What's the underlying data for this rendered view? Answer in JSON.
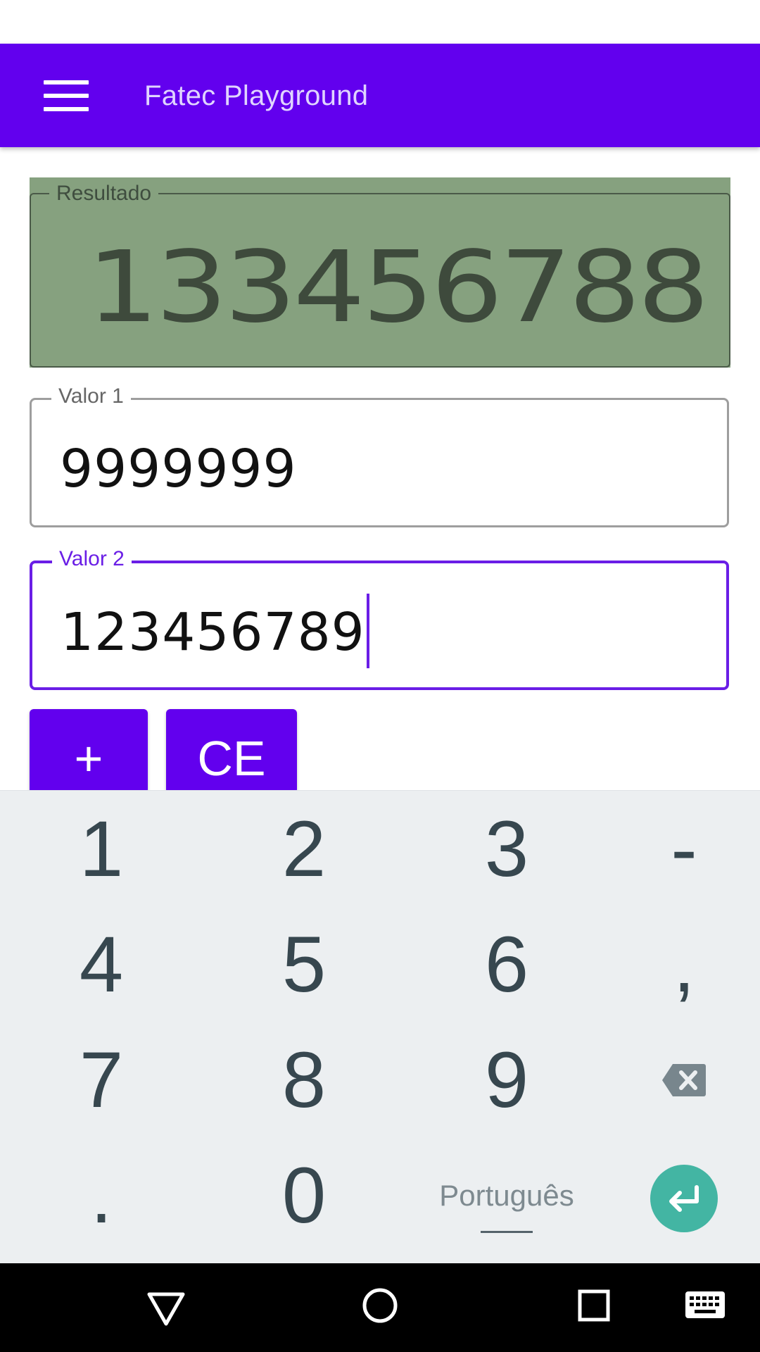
{
  "app_bar": {
    "title": "Fatec Playground",
    "menu_icon": "hamburger-menu-icon",
    "color": "#6200ee"
  },
  "result": {
    "label": "Resultado",
    "value": "133456788",
    "background": "#86a17f"
  },
  "value1": {
    "label": "Valor 1",
    "value": "9999999"
  },
  "value2": {
    "label": "Valor 2",
    "value": "123456789",
    "focused": true
  },
  "buttons": {
    "add_label": "+",
    "clear_label": "CE"
  },
  "keyboard": {
    "rows": [
      [
        "1",
        "2",
        "3",
        "-"
      ],
      [
        "4",
        "5",
        "6",
        ","
      ],
      [
        "7",
        "8",
        "9",
        "backspace-icon"
      ],
      [
        ".",
        "0",
        "Português",
        "enter-icon"
      ]
    ],
    "accent": "#43b5a3"
  },
  "nav_bar": {
    "icons": [
      "back-triangle-icon",
      "home-circle-icon",
      "recents-square-icon",
      "keyboard-icon"
    ]
  }
}
